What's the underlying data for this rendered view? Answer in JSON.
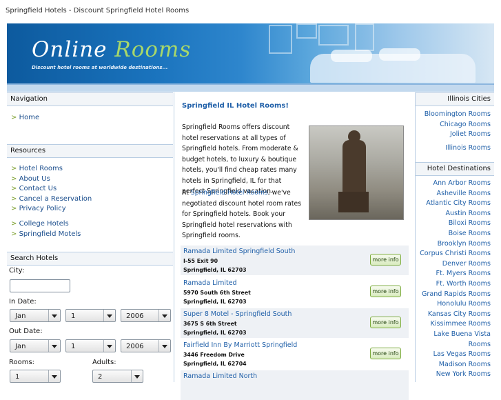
{
  "window": {
    "title": "Springfield Hotels - Discount Springfield Hotel Rooms"
  },
  "banner": {
    "logo_a": "Online",
    "logo_b": "Rooms",
    "tagline": "Discount hotel rooms at worldwide destinations..."
  },
  "navigation": {
    "title": "Navigation",
    "items": [
      "Home"
    ]
  },
  "resources": {
    "title": "Resources",
    "items": [
      "Hotel Rooms",
      "About Us",
      "Contact Us",
      "Cancel a Reservation",
      "Privacy Policy"
    ],
    "items2": [
      "College Hotels",
      "Springfield Motels"
    ]
  },
  "search": {
    "title": "Search Hotels",
    "city_label": "City:",
    "city_value": "",
    "in_label": "In Date:",
    "out_label": "Out Date:",
    "in_month": "Jan",
    "in_day": "1",
    "in_year": "2006",
    "out_month": "Jan",
    "out_day": "1",
    "out_year": "2006",
    "rooms_label": "Rooms:",
    "adults_label": "Adults:",
    "rooms_value": "1",
    "adults_value": "2"
  },
  "main": {
    "heading": "Springfield IL Hotel Rooms!",
    "para1": "Springfield Rooms offers discount hotel reservations at all types of Springfield hotels. From moderate & budget hotels, to luxury & boutique hotels, you'll find cheap rates many hotels in Springfield, IL for that perfect Springfield vacation.",
    "para2_a": "At ",
    "para2_link": "Springfield Hotel Rooms",
    "para2_b": ", we've negotiated discount hotel room rates for Springfield hotels. Book your Springfield hotel reservations with Springfield rooms.",
    "more_label": "more info",
    "hotels": [
      {
        "name": "Ramada Limited Springfield South",
        "address": "I-55 Exit 90",
        "city": "Springfield, IL 62703"
      },
      {
        "name": "Ramada Limited",
        "address": "5970 South 6th Street",
        "city": "Springfield, IL 62703"
      },
      {
        "name": "Super 8 Motel - Springfield South",
        "address": "3675 S 6th Street",
        "city": "Springfield, IL 62703"
      },
      {
        "name": "Fairfield Inn By Marriott Springfield",
        "address": "3446 Freedom Drive",
        "city": "Springfield, IL 62704"
      },
      {
        "name": "Ramada Limited North",
        "address": "",
        "city": ""
      }
    ]
  },
  "illinois": {
    "title": "Illinois Cities",
    "items": [
      "Bloomington Rooms",
      "Chicago Rooms",
      "Joliet Rooms",
      "Illinois Rooms"
    ]
  },
  "destinations": {
    "title": "Hotel Destinations",
    "items": [
      "Ann Arbor Rooms",
      "Asheville Rooms",
      "Atlantic City Rooms",
      "Austin Rooms",
      "Biloxi Rooms",
      "Boise Rooms",
      "Brooklyn Rooms",
      "Corpus Christi Rooms",
      "Denver Rooms",
      "Ft. Myers Rooms",
      "Ft. Worth Rooms",
      "Grand Rapids Rooms",
      "Honolulu Rooms",
      "Kansas City Rooms",
      "Kissimmee Rooms",
      "Lake Buena Vista",
      "Rooms",
      "Las Vegas Rooms",
      "Madison Rooms",
      "New York Rooms"
    ]
  }
}
